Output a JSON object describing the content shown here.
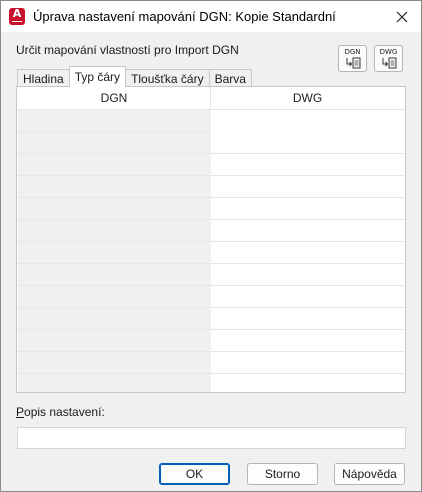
{
  "window": {
    "title": "Úprava nastavení mapování DGN: Kopie Standardní",
    "app_icon": "autocad-icon",
    "close_icon": "close-icon"
  },
  "section_label": "Určit mapování vlastností pro Import DGN",
  "toolbar": {
    "dgn_button": {
      "label": "DGN",
      "icon": "import-dgn-icon"
    },
    "dwg_button": {
      "label": "DWG",
      "icon": "import-dwg-icon"
    }
  },
  "tabs": [
    {
      "label": "Hladina",
      "active": false
    },
    {
      "label": "Typ čáry",
      "active": true
    },
    {
      "label": "Tloušťka čáry",
      "active": false
    },
    {
      "label": "Barva",
      "active": false
    }
  ],
  "grid": {
    "columns": [
      "DGN",
      "DWG"
    ],
    "rows": [
      [
        "",
        ""
      ],
      [
        "",
        ""
      ],
      [
        "",
        ""
      ],
      [
        "",
        ""
      ],
      [
        "",
        ""
      ],
      [
        "",
        ""
      ],
      [
        "",
        ""
      ],
      [
        "",
        ""
      ],
      [
        "",
        ""
      ],
      [
        "",
        ""
      ],
      [
        "",
        ""
      ],
      [
        "",
        ""
      ],
      [
        "",
        ""
      ]
    ]
  },
  "description": {
    "label_underlined": "P",
    "label_rest": "opis nastavení:",
    "value": ""
  },
  "buttons": {
    "ok": "OK",
    "cancel": "Storno",
    "help": "Nápověda"
  },
  "colors": {
    "accent": "#005fb8",
    "app_icon": "#c8102e"
  }
}
